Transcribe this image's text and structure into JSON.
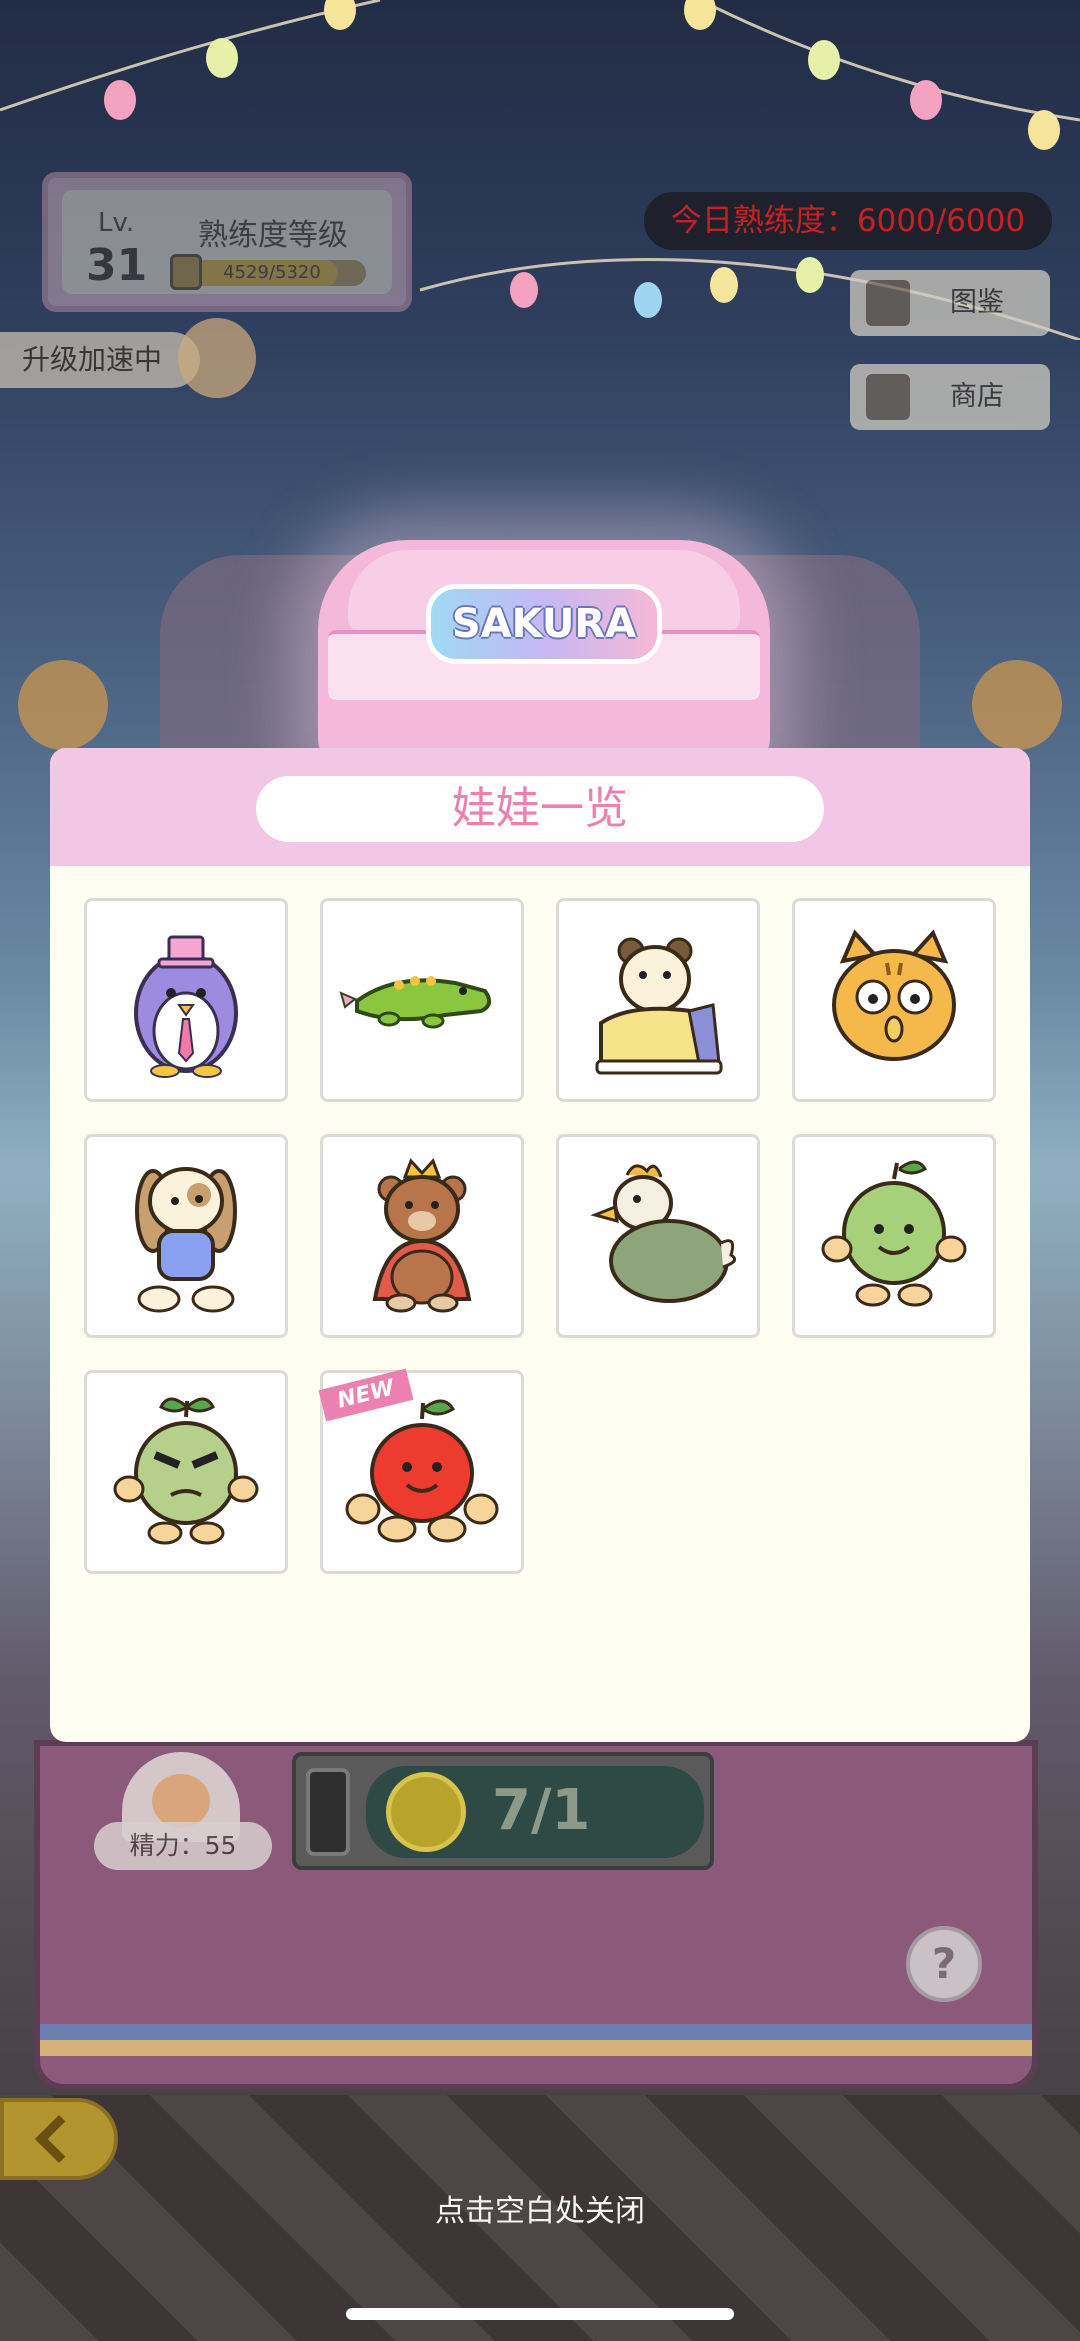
{
  "hud": {
    "lv_label": "Lv.",
    "level": "31",
    "proficiency_title": "熟练度等级",
    "progress_text": "4529/5320",
    "progress_fraction": 0.851,
    "upgrade_text": "升级加速中",
    "today_proficiency": "今日熟练度：6000/6000",
    "today_color": "#e11d1d"
  },
  "side_menu": {
    "encyclopedia": "图鉴",
    "shop": "商店"
  },
  "machine": {
    "sign_text": "SAKURA",
    "energy_text": "精力：55",
    "coin_count": "7/1",
    "help_label": "?"
  },
  "modal": {
    "title": "娃娃一览",
    "new_badge": "NEW",
    "dolls": [
      {
        "icon": "penguin-doll-icon"
      },
      {
        "icon": "crocodile-doll-icon"
      },
      {
        "icon": "hamster-shoe-doll-icon"
      },
      {
        "icon": "tiger-cat-doll-icon"
      },
      {
        "icon": "bunny-doll-icon"
      },
      {
        "icon": "king-bear-doll-icon"
      },
      {
        "icon": "duck-doll-icon"
      },
      {
        "icon": "green-apple-doll-icon"
      },
      {
        "icon": "angry-apple-doll-icon"
      },
      {
        "icon": "red-apple-doll-icon",
        "is_new": true
      }
    ]
  },
  "close_hint": "点击空白处关闭",
  "colors": {
    "accent_pink": "#ec80b0",
    "header_pink": "#f2c7e5",
    "panel_bg": "#fdfdf2"
  }
}
